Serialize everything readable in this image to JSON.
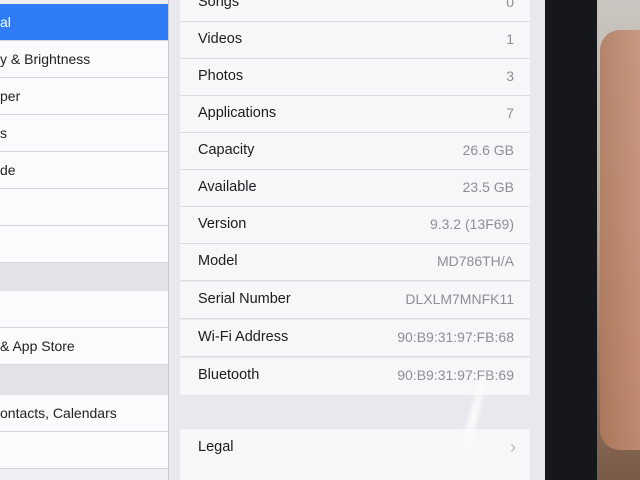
{
  "sidebar": {
    "items": [
      {
        "label": "al",
        "selected": true
      },
      {
        "label": "y & Brightness"
      },
      {
        "label": "per"
      },
      {
        "label": "s"
      },
      {
        "label": "de"
      },
      {
        "label": ""
      },
      {
        "label": ""
      },
      {
        "label": ""
      },
      {
        "label": "& App Store"
      },
      {
        "label": ""
      },
      {
        "label": "ontacts, Calendars"
      },
      {
        "label": ""
      }
    ]
  },
  "about": {
    "rows": [
      {
        "label": "Songs",
        "value": "0"
      },
      {
        "label": "Videos",
        "value": "1"
      },
      {
        "label": "Photos",
        "value": "3"
      },
      {
        "label": "Applications",
        "value": "7"
      },
      {
        "label": "Capacity",
        "value": "26.6 GB"
      },
      {
        "label": "Available",
        "value": "23.5 GB"
      },
      {
        "label": "Version",
        "value": "9.3.2 (13F69)"
      },
      {
        "label": "Model",
        "value": "MD786TH/A"
      },
      {
        "label": "Serial Number",
        "value": "DLXLM7MNFK11"
      },
      {
        "label": "Wi-Fi Address",
        "value": "90:B9:31:97:FB:68"
      },
      {
        "label": "Bluetooth",
        "value": "90:B9:31:97:FB:69"
      }
    ],
    "legal_label": "Legal",
    "chevron": "›"
  },
  "colors": {
    "accent": "#2f7cf6"
  }
}
